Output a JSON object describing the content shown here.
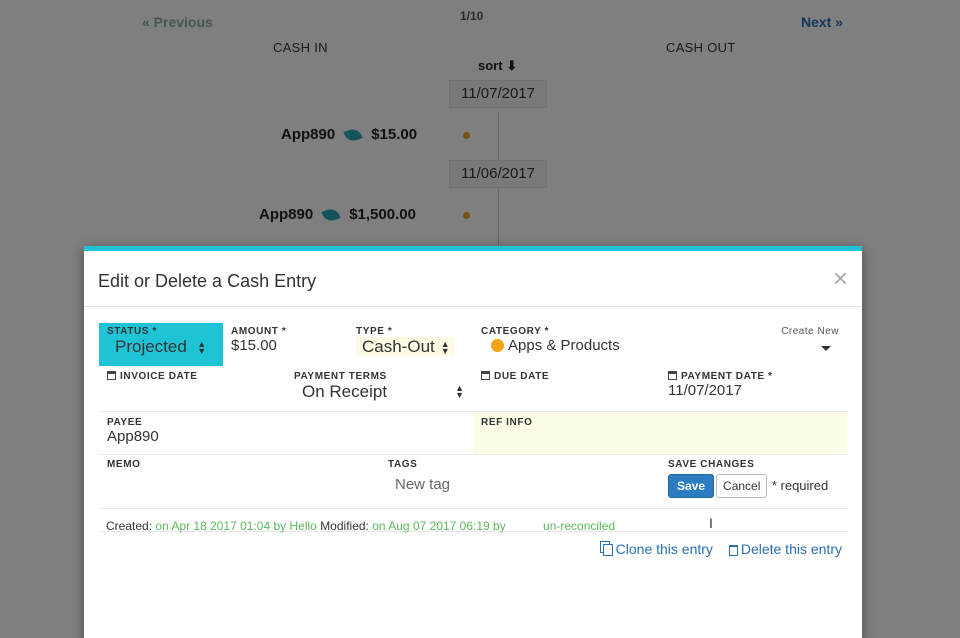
{
  "pager": {
    "previous": "« Previous",
    "count": "1/10",
    "next": "Next »"
  },
  "columns": {
    "cash_in": "CASH IN",
    "cash_out": "CASH OUT",
    "sort": "sort"
  },
  "timeline": [
    {
      "date": "11/07/2017",
      "name": "App890",
      "amount": "$15.00"
    },
    {
      "date": "11/06/2017",
      "name": "App890",
      "amount": "$1,500.00"
    }
  ],
  "modal": {
    "title": "Edit or Delete a Cash Entry",
    "close": "×",
    "status": {
      "label": "STATUS *",
      "value": "Projected"
    },
    "amount": {
      "label": "AMOUNT *",
      "value": "$15.00"
    },
    "type": {
      "label": "TYPE *",
      "value": "Cash-Out"
    },
    "category": {
      "label": "CATEGORY *",
      "create_new": "Create New",
      "value": "Apps & Products",
      "dot_color": "#f5a21b"
    },
    "invoice_date": {
      "label": "INVOICE DATE",
      "value": ""
    },
    "payment_terms": {
      "label": "PAYMENT TERMS",
      "value": "On Receipt"
    },
    "due_date": {
      "label": "DUE DATE",
      "value": ""
    },
    "payment_date": {
      "label": "PAYMENT DATE *",
      "value": "11/07/2017"
    },
    "payee": {
      "label": "PAYEE",
      "value": "App890"
    },
    "ref_info": {
      "label": "REF INFO",
      "value": ""
    },
    "memo": {
      "label": "MEMO",
      "value": ""
    },
    "tags": {
      "label": "TAGS",
      "placeholder": "New tag"
    },
    "save_changes": {
      "label": "SAVE CHANGES",
      "save": "Save",
      "cancel": "Cancel",
      "required": "* required"
    },
    "meta": {
      "created_label": "Created:",
      "created_value": "on Apr 18 2017 01:04 by Hello",
      "modified_label": "Modified:",
      "modified_value": "on Aug 07 2017 06:19 by",
      "reconcile": "un-reconciled"
    },
    "actions": {
      "clone": "Clone this entry",
      "delete": "Delete this entry"
    }
  },
  "colors": {
    "accent": "#1fc3d6",
    "primary": "#2c7cc1",
    "link": "#2a6fb0",
    "green": "#5cb85c",
    "orange": "#f5a21b"
  }
}
